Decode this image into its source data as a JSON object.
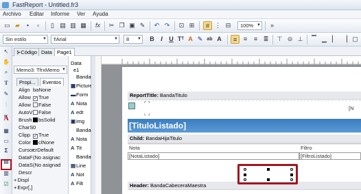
{
  "window": {
    "title": "FastReport - Untitled.fr3"
  },
  "menu": [
    "Archivo",
    "Editar",
    "Informe",
    "Ver",
    "Ayuda"
  ],
  "toolbar": {
    "zoom": "100%",
    "style": "Sin estilo",
    "font": "Arial",
    "size": "8"
  },
  "tabs": [
    "Código",
    "Data",
    "Page1"
  ],
  "inspector": {
    "object": "Memo3: TfrxMemo",
    "tabs": [
      "Propi...",
      "Eventos"
    ],
    "rows": [
      {
        "name": "Align",
        "value": "baNone",
        "check": null
      },
      {
        "name": "Allow",
        "value": "True",
        "check": true
      },
      {
        "name": "Allow",
        "value": "False",
        "check": false
      },
      {
        "name": "AutoV",
        "value": "False",
        "check": false
      },
      {
        "name": "Brush",
        "value": "bsSolid",
        "check": null,
        "swatch": "#000000"
      },
      {
        "name": "CharS",
        "value": "0",
        "check": null
      },
      {
        "name": "Clipp",
        "value": "True",
        "check": true
      },
      {
        "name": "Color",
        "value": "clNone",
        "check": null,
        "swatch": "#000000"
      },
      {
        "name": "Cursor",
        "value": "crDefault",
        "check": null
      },
      {
        "name": "DataF",
        "value": "(No asignac",
        "check": null
      },
      {
        "name": "DataS",
        "value": "(No asignad",
        "check": null
      },
      {
        "name": "Descr",
        "value": "",
        "check": null
      },
      {
        "name": "Displ",
        "value": "",
        "check": null,
        "expand": true
      },
      {
        "name": "Expr",
        "value": "[,]",
        "check": null,
        "expand": true
      }
    ]
  },
  "tree": {
    "header": [
      "Data",
      "e1"
    ],
    "items": [
      {
        "icon": "",
        "label": "BandaTi"
      },
      {
        "icon": "▦",
        "label": "Picture"
      },
      {
        "icon": "▬",
        "label": "Form"
      },
      {
        "icon": "A",
        "label": "Nota"
      },
      {
        "icon": "A",
        "label": "edt"
      },
      {
        "icon": "▣",
        "label": "img"
      },
      {
        "icon": "",
        "label": "BandaC"
      },
      {
        "icon": "A",
        "label": "Nota"
      },
      {
        "icon": "A",
        "label": "Tit"
      },
      {
        "icon": "",
        "label": "BandaH"
      },
      {
        "icon": "▤",
        "label": "Line"
      },
      {
        "icon": "A",
        "label": "Not"
      },
      {
        "icon": "A",
        "label": "Filt"
      }
    ]
  },
  "report": {
    "bands": [
      {
        "label": "ReportTitle:",
        "name": "BandaTitulo"
      },
      {
        "label": "Child:",
        "name": "BandaHijaTitulo"
      },
      {
        "label": "Header:",
        "name": "BandaCabeceraMaestra"
      }
    ],
    "title_text": "[TituloListado]",
    "nota_label": "Nota",
    "nota_field": "[NotaListado]",
    "filtro_label": "Filtro",
    "filtro_field": "[FiltroListado]",
    "edge_text": "[N"
  },
  "colors": {
    "titleBanner": "#3a7cc0",
    "highlight": "#a11521"
  }
}
